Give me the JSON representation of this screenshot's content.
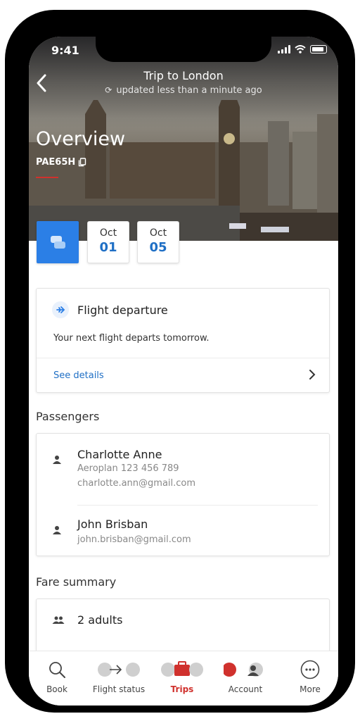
{
  "status_bar": {
    "time": "9:41"
  },
  "header": {
    "title": "Trip to London",
    "subtitle": "updated less than a minute ago"
  },
  "hero": {
    "overview": "Overview",
    "booking_ref": "PAE65H"
  },
  "dates": [
    {
      "month": "Oct",
      "day": "01"
    },
    {
      "month": "Oct",
      "day": "05"
    }
  ],
  "flight_card": {
    "title": "Flight departure",
    "text": "Your next flight departs tomorrow.",
    "link": "See details"
  },
  "passengers": {
    "title": "Passengers",
    "items": [
      {
        "name": "Charlotte Anne",
        "line1": "Aeroplan 123 456 789",
        "line2": "charlotte.ann@gmail.com"
      },
      {
        "name": "John Brisban",
        "line1": "john.brisban@gmail.com"
      }
    ]
  },
  "fare": {
    "title": "Fare summary",
    "text": "2 adults"
  },
  "tabs": [
    {
      "label": "Book",
      "icon": "search-icon"
    },
    {
      "label": "Flight status",
      "icon": "plane-icon"
    },
    {
      "label": "Trips",
      "icon": "suitcase-icon",
      "active": true
    },
    {
      "label": "Account",
      "icon": "account-icon"
    },
    {
      "label": "More",
      "icon": "more-icon"
    }
  ],
  "colors": {
    "accent": "#2b7fe6",
    "link": "#1f6fc5",
    "active_tab": "#d0312d"
  }
}
